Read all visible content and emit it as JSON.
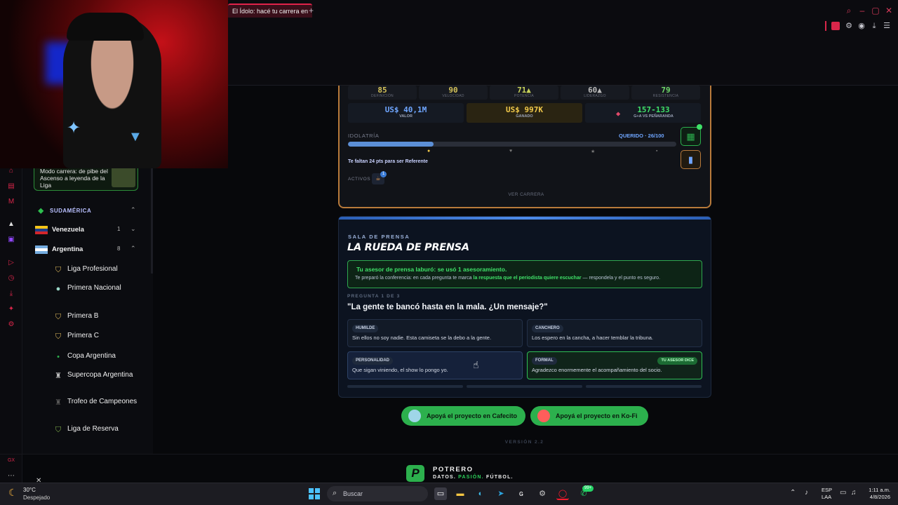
{
  "browser": {
    "tab_title": "El Ídolo: hacé tu carrera en",
    "new_tab": "+"
  },
  "sidebar": {
    "promo_text": "Modo carrera: de pibe del Ascenso a leyenda de la Liga",
    "region": {
      "label": "SUDAMÉRICA",
      "icon": "map-pin-icon"
    },
    "countries": [
      {
        "name": "Venezuela",
        "count": "1"
      },
      {
        "name": "Argentina",
        "count": "8"
      }
    ],
    "leagues": [
      {
        "name": "Liga Profesional",
        "icon": "shield-icon"
      },
      {
        "name": "Primera Nacional",
        "icon": "dot-icon"
      },
      {
        "name": "Primera B",
        "icon": "shield-icon"
      },
      {
        "name": "Primera C",
        "icon": "shield-icon"
      },
      {
        "name": "Copa Argentina",
        "icon": "cup-icon"
      },
      {
        "name": "Supercopa Argentina",
        "icon": "trophy-icon"
      },
      {
        "name": "Trofeo de Campeones",
        "icon": "trophy-icon"
      },
      {
        "name": "Liga de Reserva",
        "icon": "shield-icon"
      }
    ]
  },
  "career": {
    "stats": [
      {
        "value": "85",
        "label": "DEFINICIÓN"
      },
      {
        "value": "90",
        "label": "VELOCIDAD"
      },
      {
        "value": "71▲",
        "label": "POTENCIA"
      },
      {
        "value": "60▲",
        "label": "LIDERAZGO"
      },
      {
        "value": "79",
        "label": "RESISTENCIA"
      }
    ],
    "money": [
      {
        "value": "US$ 40,1M",
        "label": "VALOR"
      },
      {
        "value": "US$ 997K",
        "label": "GANADO"
      },
      {
        "value": "157-133",
        "label": "G+A VS PEÑARANDA"
      }
    ],
    "idolatria": {
      "label": "IDOLATRÍA",
      "status": "QUERIDO · 26/100",
      "progress": 0.26,
      "note": "Te faltan 24 pts para ser Referente"
    },
    "activos_label": "ACTIVOS",
    "activos_count": "1",
    "ver_carrera": "VER CARRERA"
  },
  "press": {
    "kicker": "SALA DE PRENSA",
    "title": "LA RUEDA DE PRENSA",
    "advisor_title": "Tu asesor de prensa laburó: se usó 1 asesoramiento.",
    "advisor_text_pre": "Te preparó la conferencia: en cada pregunta te marca ",
    "advisor_text_bold": "la respuesta que el periodista quiere escuchar",
    "advisor_text_post": " — respondela y el punto es seguro.",
    "question_counter": "PREGUNTA 1 DE 3",
    "question": "\"La gente te bancó hasta en la mala. ¿Un mensaje?\"",
    "options": [
      {
        "tag": "HUMILDE",
        "text": "Sin ellos no soy nadie. Esta camiseta se la debo a la gente."
      },
      {
        "tag": "CANCHERO",
        "text": "Los espero en la cancha, a hacer temblar la tribuna."
      },
      {
        "tag": "PERSONALIDAD",
        "text": "Que sigan viniendo, el show lo pongo yo."
      },
      {
        "tag": "FORMAL",
        "text": "Agradezco enormemente el acompañamiento del socio.",
        "advice": "TU ASESOR DICE"
      }
    ]
  },
  "support": {
    "cafecito": "Apoyá el proyecto en Cafecito",
    "kofi": "Apoyá el proyecto en Ko-Fi"
  },
  "version": "VERSIÓN 2.2",
  "brand": {
    "logo_letter": "P",
    "name": "POTRERO",
    "tag_1": "DATOS. ",
    "tag_2": "PASIÓN.",
    "tag_3": " FÚTBOL."
  },
  "taskbar": {
    "weather_temp": "30°C",
    "weather_desc": "Despejado",
    "search": "Buscar",
    "lang_1": "ESP",
    "lang_2": "LAA",
    "time": "1:11 a.m.",
    "date": "4/8/2026",
    "badge": "99+"
  },
  "colors": {
    "accent_green": "#2cb04d",
    "card_border": "#b87a3b",
    "idol_blue": "#6fa6ff"
  }
}
